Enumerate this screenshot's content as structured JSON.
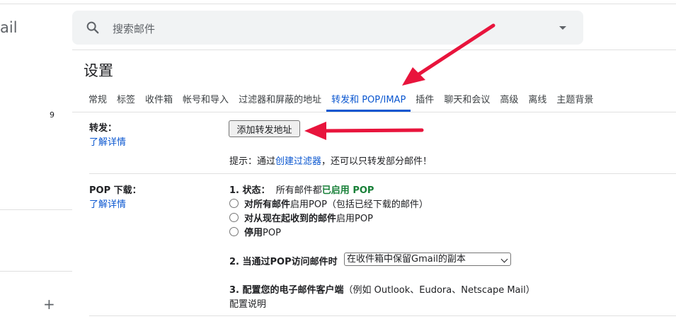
{
  "left_panel": {
    "logo_partial": "ail",
    "count": "9",
    "compose_plus": "+"
  },
  "search": {
    "placeholder": "搜索邮件",
    "icon": "search-icon",
    "options_icon": "caret-down-icon"
  },
  "page": {
    "title": "设置"
  },
  "tabs": [
    {
      "label": "常规",
      "active": false
    },
    {
      "label": "标签",
      "active": false
    },
    {
      "label": "收件箱",
      "active": false
    },
    {
      "label": "帐号和导入",
      "active": false
    },
    {
      "label": "过滤器和屏蔽的地址",
      "active": false
    },
    {
      "label": "转发和 POP/IMAP",
      "active": true
    },
    {
      "label": "插件",
      "active": false
    },
    {
      "label": "聊天和会议",
      "active": false
    },
    {
      "label": "高级",
      "active": false
    },
    {
      "label": "离线",
      "active": false
    },
    {
      "label": "主题背景",
      "active": false
    }
  ],
  "forwarding": {
    "label": "转发：",
    "learn_more": "了解详情",
    "add_button": "添加转发地址",
    "hint_prefix": "提示：通过",
    "hint_link": "创建过滤器",
    "hint_suffix": "，还可以只转发部分邮件！"
  },
  "pop": {
    "label": "POP 下载：",
    "learn_more": "了解详情",
    "status_label": "1. 状态：",
    "status_prefix": "所有邮件都",
    "status_value": "已启用 POP",
    "options": [
      {
        "bold": "对所有邮件",
        "rest": "启用POP（包括已经下载的邮件）"
      },
      {
        "bold": "对从现在起收到的邮件",
        "rest": "启用POP"
      },
      {
        "bold": "停用",
        "rest": "POP"
      }
    ],
    "when_access_label": "2. 当通过POP访问邮件时",
    "when_access_selected": "在收件箱中保留Gmail的副本",
    "configure_label": "3. 配置您的电子邮件客户端",
    "configure_hint": "（例如 Outlook、Eudora、Netscape Mail）",
    "configure_link": "配置说明"
  },
  "colors": {
    "accent": "#0b57d0",
    "enabled_green": "#188038",
    "annotation_arrow": "#e8143c"
  }
}
